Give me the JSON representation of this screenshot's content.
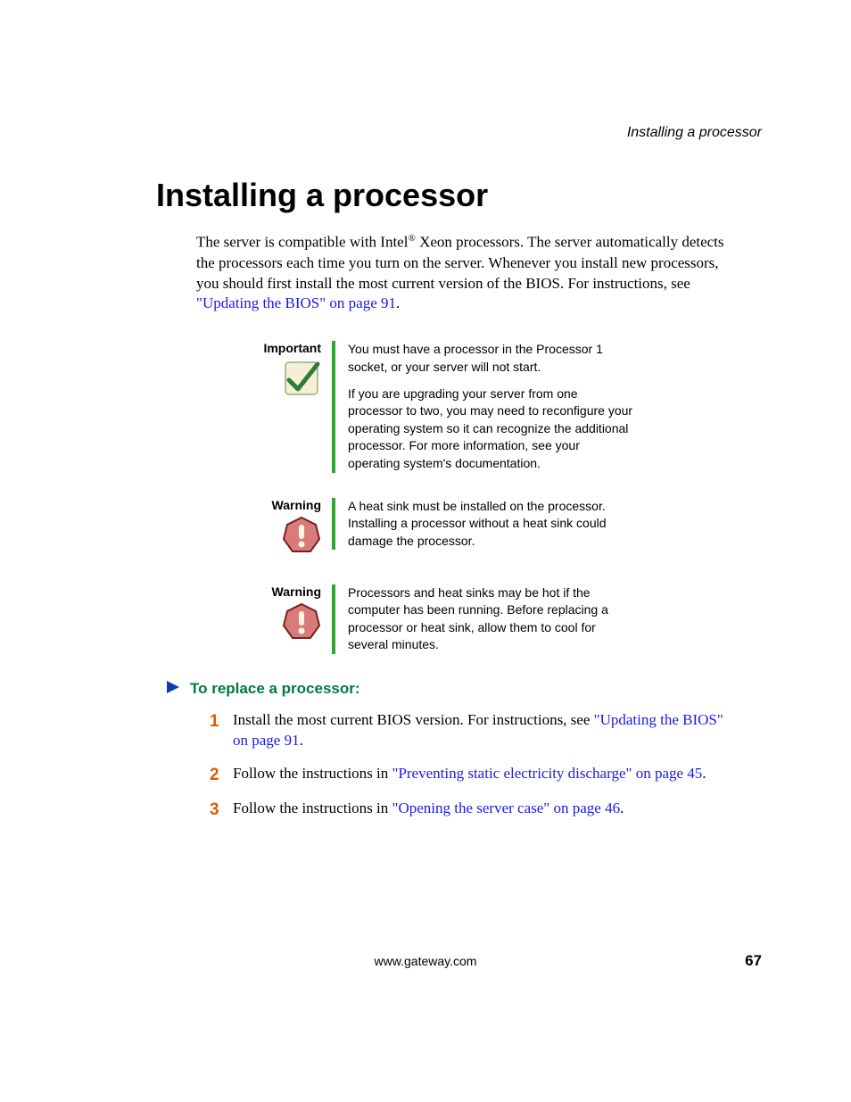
{
  "running_head": "Installing a processor",
  "title": "Installing a processor",
  "intro": {
    "part1": "The server is compatible with Intel",
    "reg": "®",
    "part2": " Xeon processors. The server automatically detects the processors each time you turn on the server. Whenever you install new processors, you should first install the most current version of the BIOS. For instructions, see ",
    "link": "\"Updating the BIOS\" on page 91",
    "part3": "."
  },
  "callouts": [
    {
      "label": "Important",
      "icon": "checkmark-icon",
      "paragraphs": [
        "You must have a processor in the Processor 1 socket, or your server will not start.",
        "If you are upgrading your server from one processor to two, you may need to reconfigure your operating system so it can recognize the additional processor. For more information, see your operating system's documentation."
      ]
    },
    {
      "label": "Warning",
      "icon": "warning-icon",
      "paragraphs": [
        "A heat sink must be installed on the processor. Installing a processor without a heat sink could damage the processor."
      ]
    },
    {
      "label": "Warning",
      "icon": "warning-icon",
      "paragraphs": [
        "Processors and heat sinks may be hot if the computer has been running. Before replacing a processor or heat sink, allow them to cool for several minutes."
      ]
    }
  ],
  "procedure_title": "To replace a processor:",
  "steps": [
    {
      "num": "1",
      "pre": "Install the most current BIOS version. For instructions, see ",
      "link": "\"Updating the BIOS\" on page 91",
      "post": "."
    },
    {
      "num": "2",
      "pre": "Follow the instructions in ",
      "link": "\"Preventing static electricity discharge\" on page 45",
      "post": "."
    },
    {
      "num": "3",
      "pre": "Follow the instructions in ",
      "link": "\"Opening the server case\" on page 46",
      "post": "."
    }
  ],
  "footer": {
    "url": "www.gateway.com",
    "page": "67"
  }
}
